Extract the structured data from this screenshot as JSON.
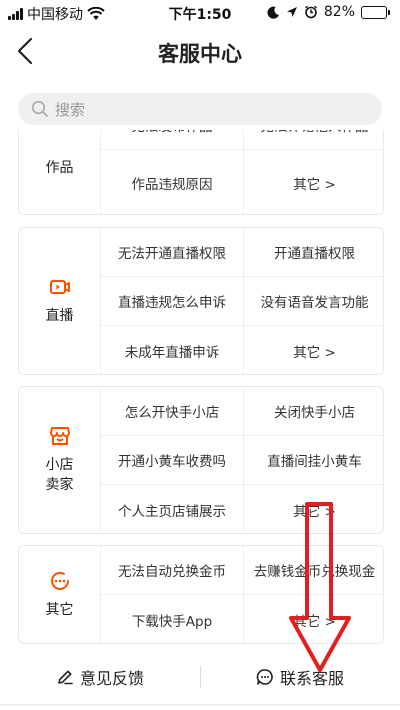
{
  "status_bar": {
    "carrier": "中国移动",
    "time": "下午1:50",
    "battery_percent": "82%",
    "battery_level": 0.82,
    "icons": [
      "signal-icon",
      "wifi-icon",
      "moon-icon",
      "location-icon",
      "alarm-icon",
      "battery-icon"
    ]
  },
  "nav": {
    "title": "客服中心",
    "back_icon": "chevron-left-icon"
  },
  "search": {
    "placeholder": "搜索",
    "icon": "search-icon"
  },
  "categories": [
    {
      "name": "作品",
      "items": [
        "无法发布作品",
        "无法评论他人作品",
        "作品违规原因",
        "其它 >"
      ]
    },
    {
      "name": "直播",
      "icon": "live-video-icon",
      "items": [
        "无法开通直播权限",
        "开通直播权限",
        "直播违规怎么申诉",
        "没有语音发言功能",
        "未成年直播申诉",
        "其它 >"
      ]
    },
    {
      "name": "小店卖家",
      "name_lines": [
        "小店",
        "卖家"
      ],
      "icon": "store-icon",
      "items": [
        "怎么开快手小店",
        "关闭快手小店",
        "开通小黄车收费吗",
        "直播间挂小黄车",
        "个人主页店铺展示",
        "其它 >"
      ]
    },
    {
      "name": "其它",
      "icon": "more-circle-icon",
      "items": [
        "无法自动兑换金币",
        "去赚钱金币兑换现金",
        "下载快手App",
        "其它 >"
      ]
    }
  ],
  "bottom": {
    "feedback_label": "意见反馈",
    "feedback_icon": "edit-icon",
    "contact_label": "联系客服",
    "contact_icon": "chat-icon"
  },
  "colors": {
    "accent": "#ff5000",
    "annotation_arrow": "#e02020",
    "text": "#222222",
    "border": "#eeeeee"
  }
}
